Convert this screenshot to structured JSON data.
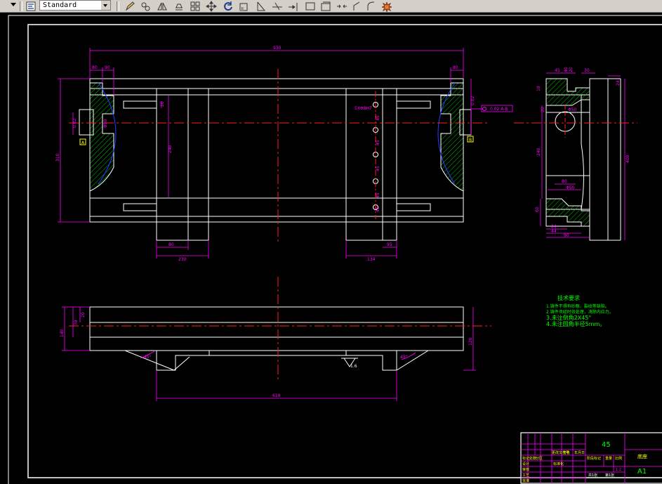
{
  "toolbar": {
    "text_style_value": "Standard",
    "icons": [
      "text-style-icon",
      "pencil-icon",
      "offset-icon",
      "mirror-icon",
      "array-icon",
      "grid-icon",
      "move-icon",
      "rotate-icon",
      "scale-icon",
      "stretch-icon",
      "trim-icon",
      "extend-icon",
      "rectangle-icon",
      "box-icon",
      "break-icon",
      "chamfer-icon",
      "fillet-icon",
      "explode-icon"
    ]
  },
  "colors": {
    "background": "#000000",
    "geometry": "#ffffff",
    "dimension": "#ff00ff",
    "centerline": "#ff2020",
    "hatch": "#00c000",
    "arc": "#2040ff",
    "note_text": "#00ff00",
    "label_text": "#ffff00",
    "title_block": "#ff00ff"
  },
  "drawing": {
    "top_view_dims": {
      "overall_width": "930",
      "left_a": "80",
      "left_b": "90",
      "right_a": "80",
      "left_height": "310",
      "inner_height": "240",
      "small_a": "20",
      "bottom_left_a": "80",
      "bottom_left_b": "230",
      "bottom_right_a": "95",
      "bottom_right_b": "134",
      "right_tol": "0.02",
      "left_tol": "0.02",
      "hole_note": "5XΦ8H7",
      "hole_pitch": [
        "45",
        "45",
        "45",
        "45",
        "45"
      ],
      "datum_a": "A",
      "datum_b": "B",
      "tol_frame": "0.02 A-B",
      "diam_left": "Φ50"
    },
    "side_view_dims": {
      "top_a": "45",
      "top_b": "40",
      "top_c": "20",
      "top_d": "30",
      "height_total": "400",
      "height_inner": "240",
      "side_a": "18",
      "side_b": "20",
      "diam": "Φ50",
      "bottom_a": "60",
      "bottom_b": "34",
      "bottom_c": "44",
      "bottom_d": "90",
      "mid_a": "80",
      "mid_b": "Φ50",
      "side_c": "24"
    },
    "front_view_dims": {
      "height_a": "20",
      "height_b": "78",
      "height_c": "140",
      "right_h": "120",
      "width_total": "610",
      "angle_left": "45°",
      "angle_right": "45°",
      "surface": "1.6"
    },
    "tech_notes": {
      "title": "技术要求",
      "lines": [
        "1.铸件不得有砂眼、裂纹等缺陷。",
        "2.铸件须经时效处理，消除内应力。",
        "3.未注倒角2X45°",
        "4.未注圆角半径5mm。"
      ]
    },
    "title_block": {
      "material": "45",
      "part_name": "底座",
      "sheet_size": "A1",
      "scale": "1:2",
      "sheets": "共1张",
      "sheet_no": "第1张",
      "labels": [
        "标记",
        "处数",
        "分区",
        "更改文件号",
        "签名",
        "年月日",
        "设计",
        "标准化",
        "阶段标记",
        "重量",
        "比例",
        "审核",
        "工艺",
        "批准"
      ]
    }
  }
}
